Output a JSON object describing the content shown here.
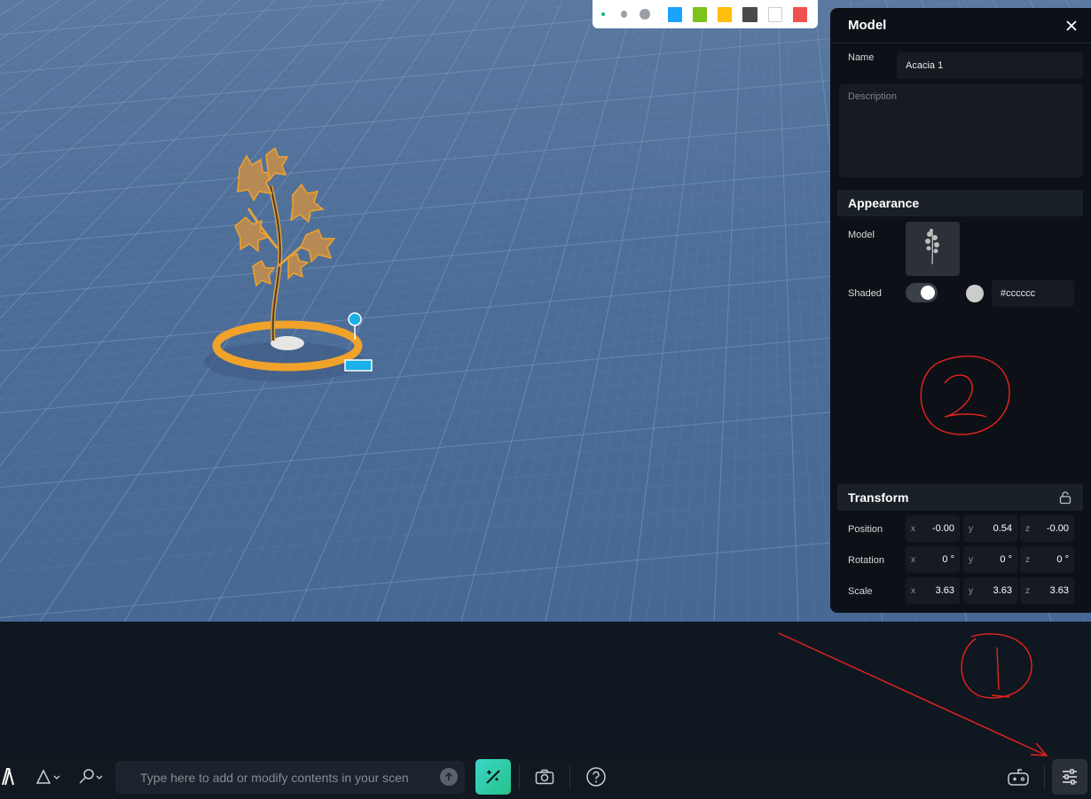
{
  "palette": {
    "colors": [
      "#1aa3ff",
      "#7ec31a",
      "#ffbe0b",
      "#4a4a4a",
      "#ffffff",
      "#f05050"
    ]
  },
  "panel": {
    "title": "Model",
    "name_label": "Name",
    "name_value": "Acacia 1",
    "description_placeholder": "Description",
    "appearance": {
      "title": "Appearance",
      "model_label": "Model",
      "shaded_label": "Shaded",
      "shaded_on": true,
      "color_hex": "#cccccc"
    },
    "transform": {
      "title": "Transform",
      "position_label": "Position",
      "rotation_label": "Rotation",
      "scale_label": "Scale",
      "position": {
        "x": "-0.00",
        "y": "0.54",
        "z": "-0.00"
      },
      "rotation": {
        "x": "0 °",
        "y": "0 °",
        "z": "0 °"
      },
      "scale": {
        "x": "3.63",
        "y": "3.63",
        "z": "3.63"
      },
      "axis_x": "x",
      "axis_y": "y",
      "axis_z": "z"
    }
  },
  "toolbar": {
    "prompt_placeholder": "Type here to add or modify contents in your scen"
  },
  "colors": {
    "selection_outline": "#f5a623",
    "annotation": "#e8231e",
    "accent_gradient": "#2fcaa8"
  }
}
